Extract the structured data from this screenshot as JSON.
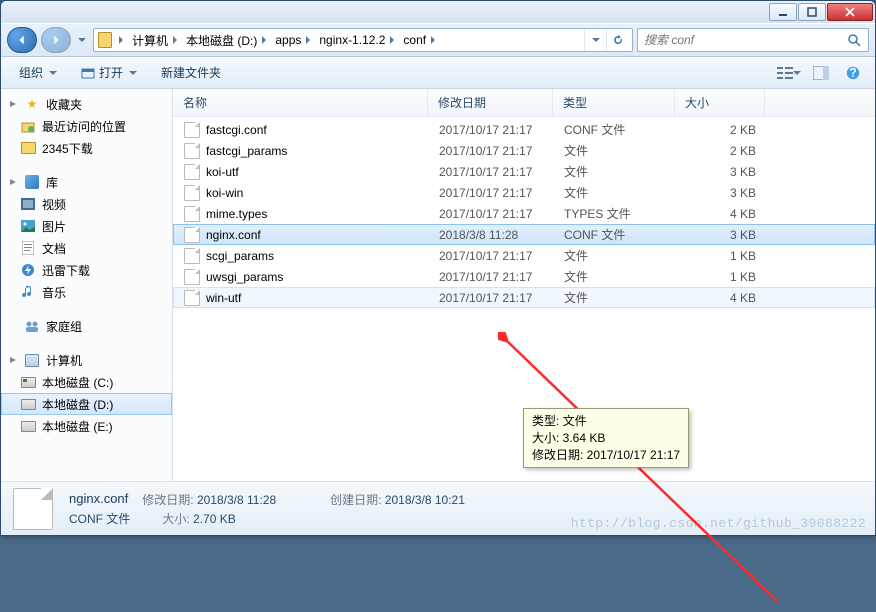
{
  "window": {
    "min_label": "Minimize",
    "max_label": "Maximize",
    "close_label": "Close"
  },
  "breadcrumbs": [
    "计算机",
    "本地磁盘 (D:)",
    "apps",
    "nginx-1.12.2",
    "conf"
  ],
  "search": {
    "placeholder": "搜索 conf"
  },
  "toolbar": {
    "organize": "组织",
    "open": "打开",
    "new_folder": "新建文件夹"
  },
  "sidebar": {
    "favorites": {
      "label": "收藏夹",
      "items": [
        {
          "label": "最近访问的位置",
          "icon": "recent"
        },
        {
          "label": "2345下载",
          "icon": "folder"
        }
      ]
    },
    "libraries": {
      "label": "库",
      "items": [
        {
          "label": "视频",
          "icon": "video"
        },
        {
          "label": "图片",
          "icon": "picture"
        },
        {
          "label": "文档",
          "icon": "document"
        },
        {
          "label": "迅雷下载",
          "icon": "thunder"
        },
        {
          "label": "音乐",
          "icon": "music"
        }
      ]
    },
    "homegroup": {
      "label": "家庭组"
    },
    "computer": {
      "label": "计算机",
      "items": [
        {
          "label": "本地磁盘 (C:)",
          "icon": "drive-c"
        },
        {
          "label": "本地磁盘 (D:)",
          "icon": "drive",
          "selected": true
        },
        {
          "label": "本地磁盘 (E:)",
          "icon": "drive"
        }
      ]
    }
  },
  "columns": {
    "name": "名称",
    "date": "修改日期",
    "type": "类型",
    "size": "大小"
  },
  "files": [
    {
      "name": "fastcgi.conf",
      "date": "2017/10/17 21:17",
      "type": "CONF 文件",
      "size": "2 KB"
    },
    {
      "name": "fastcgi_params",
      "date": "2017/10/17 21:17",
      "type": "文件",
      "size": "2 KB"
    },
    {
      "name": "koi-utf",
      "date": "2017/10/17 21:17",
      "type": "文件",
      "size": "3 KB"
    },
    {
      "name": "koi-win",
      "date": "2017/10/17 21:17",
      "type": "文件",
      "size": "3 KB"
    },
    {
      "name": "mime.types",
      "date": "2017/10/17 21:17",
      "type": "TYPES 文件",
      "size": "4 KB"
    },
    {
      "name": "nginx.conf",
      "date": "2018/3/8 11:28",
      "type": "CONF 文件",
      "size": "3 KB",
      "selected": true
    },
    {
      "name": "scgi_params",
      "date": "2017/10/17 21:17",
      "type": "文件",
      "size": "1 KB"
    },
    {
      "name": "uwsgi_params",
      "date": "2017/10/17 21:17",
      "type": "文件",
      "size": "1 KB"
    },
    {
      "name": "win-utf",
      "date": "2017/10/17 21:17",
      "type": "文件",
      "size": "4 KB",
      "hover": true
    }
  ],
  "tooltip": {
    "line1": "类型: 文件",
    "line2": "大小: 3.64 KB",
    "line3": "修改日期: 2017/10/17 21:17"
  },
  "statusbar": {
    "filename": "nginx.conf",
    "filetype": "CONF 文件",
    "mod_label": "修改日期:",
    "mod_val": "2018/3/8 11:28",
    "size_label": "大小:",
    "size_val": "2.70 KB",
    "created_label": "创建日期:",
    "created_val": "2018/3/8 10:21"
  },
  "watermark": "http://blog.csdn.net/github_39088222",
  "colors": {
    "accent": "#3a7abd",
    "selection": "#cde5fb",
    "arrow": "#ff2a2a"
  }
}
